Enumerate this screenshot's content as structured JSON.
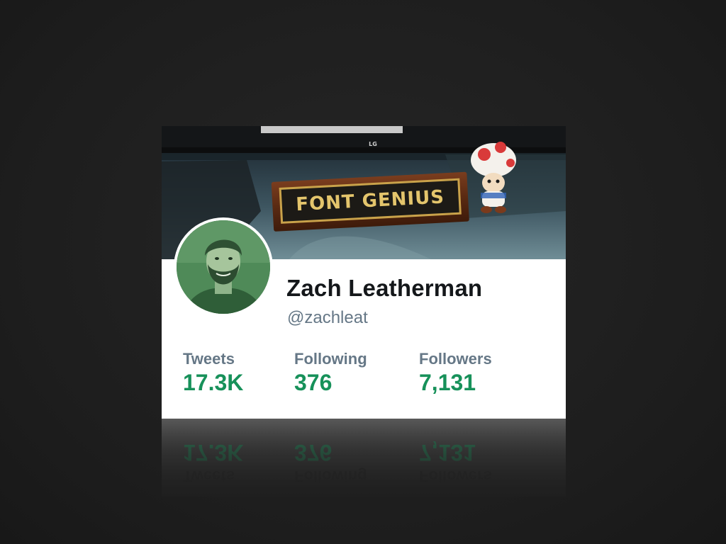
{
  "profile": {
    "name": "Zach Leatherman",
    "handle": "@zachleat"
  },
  "banner": {
    "plaque_text": "FONT GENIUS",
    "monitor_brand": "LG"
  },
  "stats": {
    "tweets": {
      "label": "Tweets",
      "value": "17.3K"
    },
    "following": {
      "label": "Following",
      "value": "376"
    },
    "followers": {
      "label": "Followers",
      "value": "7,131"
    }
  },
  "colors": {
    "background": "#1f1f1f",
    "card": "#ffffff",
    "name_text": "#14171a",
    "muted_text": "#657786",
    "stat_value": "#17915a",
    "avatar_tint": "#3f7a4a"
  }
}
